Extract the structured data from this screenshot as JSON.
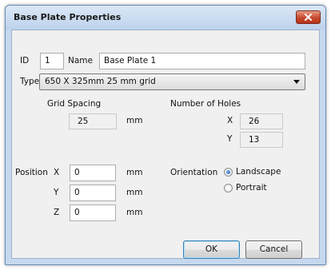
{
  "window": {
    "title": "Base Plate Properties"
  },
  "plate": {
    "id_label": "ID",
    "id_value": "1",
    "name_label": "Name",
    "name_value": "Base Plate 1",
    "type_label": "Type",
    "type_value": "650 X 325mm 25 mm grid"
  },
  "grid": {
    "heading": "Grid Spacing",
    "value": "25",
    "unit": "mm"
  },
  "holes": {
    "heading": "Number of Holes",
    "x_label": "X",
    "x_value": "26",
    "y_label": "Y",
    "y_value": "13"
  },
  "position": {
    "label": "Position",
    "x_label": "X",
    "x_value": "0",
    "y_label": "Y",
    "y_value": "0",
    "z_label": "Z",
    "z_value": "0",
    "unit": "mm"
  },
  "orientation": {
    "label": "Orientation",
    "options": [
      "Landscape",
      "Portrait"
    ],
    "selected": "Landscape"
  },
  "buttons": {
    "ok": "OK",
    "cancel": "Cancel"
  },
  "colors": {
    "close_button": "#c74a2e",
    "title_bar": "#c5d8ee",
    "client": "#f0f0f0"
  },
  "icons": {
    "close": "close-icon",
    "dropdown": "chevron-down-icon"
  }
}
